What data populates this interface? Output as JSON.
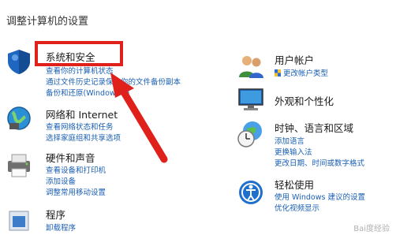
{
  "page": {
    "title": "调整计算机的设置"
  },
  "left_categories": [
    {
      "title": "系统和安全",
      "links": [
        "查看你的计算机状态",
        "通过文件历史记录保存你的文件备份副本",
        "备份和还原(Windows 7)"
      ]
    },
    {
      "title": "网络和 Internet",
      "links": [
        "查看网络状态和任务",
        "选择家庭组和共享选项"
      ]
    },
    {
      "title": "硬件和声音",
      "links": [
        "查看设备和打印机",
        "添加设备",
        "调整常用移动设置"
      ]
    },
    {
      "title": "程序",
      "links": [
        "卸载程序"
      ]
    }
  ],
  "right_categories": [
    {
      "title": "用户帐户",
      "links": [
        "更改帐户类型"
      ]
    },
    {
      "title": "外观和个性化",
      "links": []
    },
    {
      "title": "时钟、语言和区域",
      "links": [
        "添加语言",
        "更换输入法",
        "更改日期、时间或数字格式"
      ]
    },
    {
      "title": "轻松使用",
      "links": [
        "使用 Windows 建议的设置",
        "优化视频显示"
      ]
    }
  ],
  "icons": {
    "system_security": "shield-icon",
    "network": "globe-network-icon",
    "hardware": "printer-icon",
    "programs": "programs-icon",
    "user_accounts": "users-icon",
    "appearance": "monitor-icon",
    "clock": "clock-globe-icon",
    "ease_of_access": "ease-of-access-icon",
    "uac": "uac-shield-icon"
  },
  "colors": {
    "link": "#1a5fb4",
    "highlight": "#e0201b",
    "text": "#1a1a1a"
  },
  "watermark": "Bai度经验"
}
